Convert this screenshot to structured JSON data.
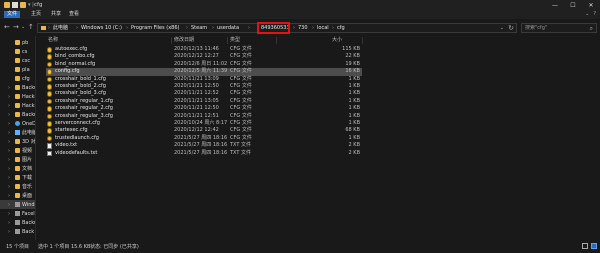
{
  "window": {
    "title": "cfg",
    "title_prefix_arrow": "▾ |"
  },
  "ribbon": {
    "tabs": [
      "文件",
      "主页",
      "共享",
      "查看"
    ],
    "expand_icon": "chevron-down-icon",
    "help_icon": "help-icon"
  },
  "address": {
    "crumbs": [
      "此电脑",
      "Windows 10 (C:)",
      "Program Files (x86)",
      "Steam",
      "userdata",
      "849360533",
      "730",
      "local",
      "cfg"
    ],
    "highlighted_crumb": "849360533",
    "highlight_color": "#e01414"
  },
  "search": {
    "placeholder": "搜索\"cfg\""
  },
  "sidebar": {
    "items": [
      {
        "label": "pb",
        "type": "folder"
      },
      {
        "label": "cs",
        "type": "folder"
      },
      {
        "label": "csc",
        "type": "folder"
      },
      {
        "label": "pla",
        "type": "folder"
      },
      {
        "label": "cfg",
        "type": "folder"
      },
      {
        "label": "Backu",
        "type": "folder"
      },
      {
        "label": "Hackn",
        "type": "folder"
      },
      {
        "label": "Hackn",
        "type": "folder"
      },
      {
        "label": "Backu",
        "type": "folder"
      },
      {
        "label": "OneDri",
        "type": "cloud"
      },
      {
        "label": "此电脑",
        "type": "pc"
      },
      {
        "label": "3D 对",
        "type": "folder"
      },
      {
        "label": "视频",
        "type": "folder"
      },
      {
        "label": "图片",
        "type": "folder"
      },
      {
        "label": "文档",
        "type": "folder"
      },
      {
        "label": "下载",
        "type": "folder"
      },
      {
        "label": "音乐",
        "type": "folder"
      },
      {
        "label": "桌面",
        "type": "folder"
      },
      {
        "label": "Windo",
        "type": "drive"
      },
      {
        "label": "Faceli",
        "type": "drive"
      },
      {
        "label": "Backu",
        "type": "drive"
      },
      {
        "label": "Back",
        "type": "drive"
      }
    ]
  },
  "table": {
    "headers": {
      "name": "名称",
      "date": "修改日期",
      "type": "类型",
      "size": "大小"
    },
    "rows": [
      {
        "name": "autoexec.cfg",
        "date": "2020/12/13 11:46",
        "type": "CFG 文件",
        "size": "115 KB",
        "icon": "cfg"
      },
      {
        "name": "bind_combo.cfg",
        "date": "2020/12/12 12:27",
        "type": "CFG 文件",
        "size": "22 KB",
        "icon": "cfg"
      },
      {
        "name": "bind_normal.cfg",
        "date": "2020/12/6 周日 11:02",
        "type": "CFG 文件",
        "size": "19 KB",
        "icon": "cfg"
      },
      {
        "name": "config.cfg",
        "date": "2020/12/5 周六 11:39",
        "type": "CFG 文件",
        "size": "16 KB",
        "icon": "cfg",
        "selected": true
      },
      {
        "name": "crosshair_bold_1.cfg",
        "date": "2020/11/21 13:09",
        "type": "CFG 文件",
        "size": "1 KB",
        "icon": "cfg"
      },
      {
        "name": "crosshair_bold_2.cfg",
        "date": "2020/11/21 12:50",
        "type": "CFG 文件",
        "size": "1 KB",
        "icon": "cfg"
      },
      {
        "name": "crosshair_bold_3.cfg",
        "date": "2020/11/21 12:52",
        "type": "CFG 文件",
        "size": "1 KB",
        "icon": "cfg"
      },
      {
        "name": "crosshair_regular_1.cfg",
        "date": "2020/11/21 13:05",
        "type": "CFG 文件",
        "size": "1 KB",
        "icon": "cfg"
      },
      {
        "name": "crosshair_regular_2.cfg",
        "date": "2020/11/21 12:50",
        "type": "CFG 文件",
        "size": "1 KB",
        "icon": "cfg"
      },
      {
        "name": "crosshair_regular_3.cfg",
        "date": "2020/11/21 12:51",
        "type": "CFG 文件",
        "size": "1 KB",
        "icon": "cfg"
      },
      {
        "name": "serverconnect.cfg",
        "date": "2020/10/24 周六 8:17",
        "type": "CFG 文件",
        "size": "1 KB",
        "icon": "cfg"
      },
      {
        "name": "startexec.cfg",
        "date": "2020/12/12 12:42",
        "type": "CFG 文件",
        "size": "68 KB",
        "icon": "cfg"
      },
      {
        "name": "trustedlaunch.cfg",
        "date": "2021/5/27 周四 18:16",
        "type": "CFG 文件",
        "size": "1 KB",
        "icon": "cfg"
      },
      {
        "name": "video.txt",
        "date": "2021/5/27 周四 18:16",
        "type": "TXT 文件",
        "size": "2 KB",
        "icon": "txt"
      },
      {
        "name": "videodefaults.txt",
        "date": "2021/5/27 周四 18:16",
        "type": "TXT 文件",
        "size": "2 KB",
        "icon": "txt"
      }
    ]
  },
  "status": {
    "count": "15 个项目",
    "selected": "选中 1 个项目 15.6 KB",
    "sync": "状态: 已同步 (已共享)"
  },
  "colors": {
    "accent": "#2b6cb8",
    "selection": "#4d4d4d",
    "background": "#191919"
  }
}
